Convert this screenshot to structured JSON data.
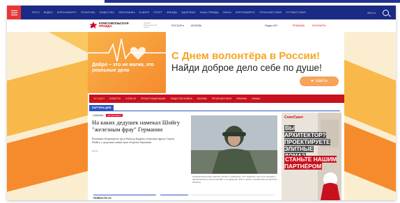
{
  "nav": {
    "items": [
      "ФОТО",
      "ВИДЕО",
      "КОРОНАВИРУС",
      "ПОЛИТИКА",
      "ОБЩЕСТВО",
      "ЭКОНОМИКА",
      "В МИРЕ",
      "СПОРТ",
      "ЗВЕЗДЫ",
      "ЗДОРОВЬЕ",
      "НАША ПРАВДА",
      "НАУКА",
      "КОРОНАВИРУС",
      "ПРОИСШЕСТВИЯ",
      "ПУТЕШЕСТВИЯ"
    ],
    "region_code": "RED ▾"
  },
  "header": {
    "logo_line1": "КОМСОМОЛЬСКАЯ",
    "logo_line2": "ПРАВДА",
    "jubilee": "Первой Национальной Газете",
    "region": "РОССИЯ ▾",
    "city": "МОСКВА",
    "live": "Радио КП",
    "advertising": "РЕКЛАМА",
    "contacts": "КОНТАКТЫ"
  },
  "banner": {
    "left_text": "Добро – это не магия, это реальные дела",
    "title": "С Днем волонтёра в России!",
    "subtitle": "Найди доброе дело себе по душе!",
    "button": "Найти"
  },
  "rubrics": {
    "items": [
      "СЕГОДНЯ",
      "НОВОСТИ",
      "COVID-19",
      "ПРОКАТ МАЦЕНАЦИИ",
      "ОБЩЕСТВО ВОЙНА",
      "МОСКВА",
      "ПРОИСШЕСТВИЯ",
      "УКРАИНА",
      "АФИША"
    ]
  },
  "section": {
    "label": "КАРТИНА ДНЯ"
  },
  "article": {
    "tag1": "ПОЛИТИКА",
    "tag2": "ЭКСКЛЮЗИВ КП",
    "headline": "На каких дедушек намекал Шойгу \"железным фрау\" Германии",
    "lead": "Военный обозреватель kp.ru Виктор Баранец объясняет фразу Сергея Шойгу о дедушках министров обороны Германии",
    "readmore": "Далее",
    "caption": "Отвечая министру обороны Литвы и заявлений, что \"дедушки\" Эти кто напомнил объединяться в министра ФРГ и ее фрау-мы. Фото: архив о приёме Министерства обороны"
  },
  "ad": {
    "logo": "СоюзГрант",
    "question": "ВЫ АРХИТЕКТОР? ПРОЕКТИРУЕТЕ ЭЛИТНЫЕ ДОМА?",
    "cta": "СТАНЬТЕ НАШИМ ПАРТНЁРОМ"
  },
  "news": {
    "title": "НОВОСТИ 24"
  },
  "colors": {
    "nav_bg": "#1b2a84",
    "accent_red": "#c8101e",
    "banner_orange": "#f5a623",
    "section_blue": "#2e56c4"
  }
}
